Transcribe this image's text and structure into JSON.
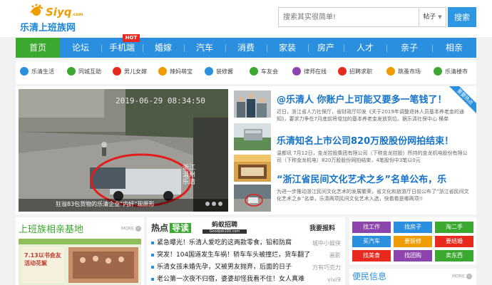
{
  "header": {
    "logo_word": "Siyq",
    "logo_domain": ".com",
    "logo_cn": "乐清上班族网",
    "search_placeholder": "搜索其实很简单!",
    "search_type": "帖子",
    "search_button": "搜索"
  },
  "nav": {
    "items": [
      "首页",
      "论坛",
      "手机端",
      "婚嫁",
      "汽车",
      "消费",
      "家装",
      "房产",
      "人才",
      "亲子",
      "相亲"
    ],
    "hot_badge": "HOT"
  },
  "categories": [
    {
      "label": "乐清生活",
      "color": "#2b8fdf"
    },
    {
      "label": "同城互助",
      "color": "#3ba92f"
    },
    {
      "label": "男儿女嫁",
      "color": "#e8291d"
    },
    {
      "label": "辣妈萌宝",
      "color": "#ef9c00"
    },
    {
      "label": "装修酱",
      "color": "#2b8fdf"
    },
    {
      "label": "车友会",
      "color": "#3ba92f"
    },
    {
      "label": "律师在线",
      "color": "#8e44ad"
    },
    {
      "label": "招聘求职",
      "color": "#e8291d"
    },
    {
      "label": "跳蚤市场",
      "color": "#ef9c00"
    },
    {
      "label": "乐清楼市",
      "color": "#3ba92f"
    }
  ],
  "slide": {
    "date": "2019-06-29  08:34:50",
    "side_text": "浙江温州乐清",
    "caption": "狂溢83包货物的乐清企业“内奸”现原形"
  },
  "ribbon": "重要热点",
  "news": [
    {
      "title": "@乐清人 你账户上可能又要多一笔钱了！",
      "desc": "近日，浙江省人力社保厅，省财政厅印发《关于2019年调整退休人员基本养老金的通知》，要求力争在7月底前将增加的基本养老金发放到位。据乐清社保中心 横单"
    },
    {
      "title": "乐清知名上市公司820万股股份网拍结束！",
      "desc": "温都讯 7月12日，金龙控股集团有限公司（下称金龙控股）所持的金龙机电股份有限公司（下称金龙机电）820万股股份网拍结束，4笔股份中3笔以0元"
    },
    {
      "title": "“浙江省民间文化艺术之乡”名单公布，乐",
      "desc": "为进一步推动浙江民间文化艺术的发展繁荣，省文化和旅游厅日前公布了“浙江省民间文化艺术之乡”名单，乐清两项民间文化艺术入选，快看看是哪两项!!"
    }
  ],
  "left_panel": {
    "title": "上班族相亲基地",
    "more": "MORE",
    "img_text": "7.13以书会友 活动花絮"
  },
  "hot_panel": {
    "title_a": "热点",
    "title_b": "导读",
    "ant_logo": "蚂蚁招聘",
    "ant_domain": "Goodjob100.com",
    "report": "我要报料",
    "items": [
      {
        "text": "紧急曝光！乐清人爱吃的这两款零食，铅和防腐",
        "src": "城中小娱侠"
      },
      {
        "text": "突发！104国道发生车祸！轿车车头被撞烂，货车翻了",
        "src": "画影"
      },
      {
        "text": "乐清女孩未婚先孕，又被男友抛弃，后面的日子",
        "src": "万有巧克力"
      },
      {
        "text": "老公第一次夜不归宿，婆婆却怪我看不住！女人真难",
        "src": "vivi9"
      }
    ]
  },
  "quick_buttons": [
    {
      "label": "找工作",
      "color": "#8e44ad"
    },
    {
      "label": "找房子",
      "color": "#2b8fdf"
    },
    {
      "label": "淘二手",
      "color": "#3ba92f"
    },
    {
      "label": "买汽车",
      "color": "#2b8fdf"
    },
    {
      "label": "要装修",
      "color": "#ef9c00"
    },
    {
      "label": "要结婚",
      "color": "#e8291d"
    },
    {
      "label": "找美食",
      "color": "#e8291d"
    },
    {
      "label": "找团购",
      "color": "#8e44ad"
    },
    {
      "label": "卖东西",
      "color": "#3ba92f"
    }
  ],
  "bianmin": {
    "title": "便民信息",
    "more": "MORE"
  }
}
